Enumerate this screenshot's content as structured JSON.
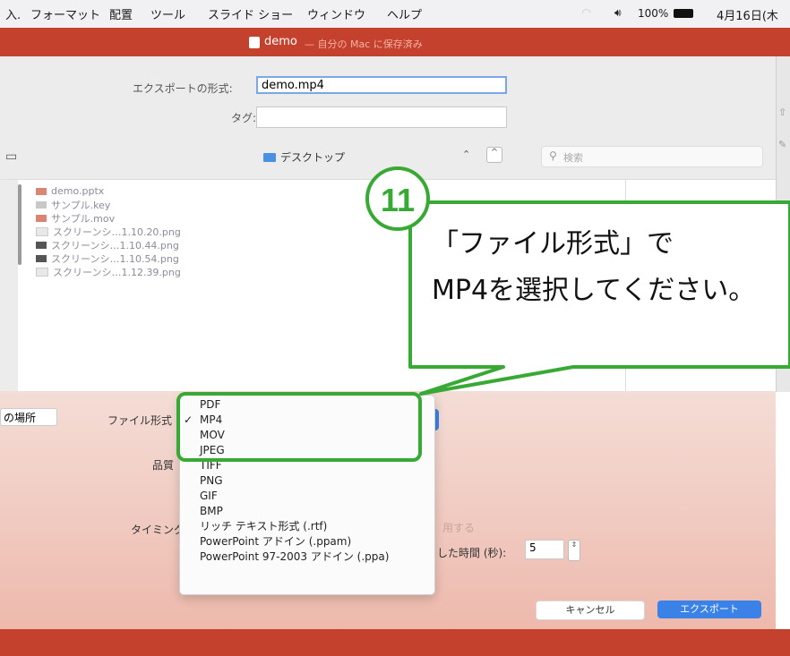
{
  "menubar": {
    "items": [
      "入.",
      "フォーマット",
      "配置",
      "ツール",
      "スライド ショー",
      "ウィンドウ",
      "ヘルプ"
    ],
    "volume_icon": "speaker-icon",
    "battery_text": "100%",
    "date_text": "4月16日(木"
  },
  "titlebar": {
    "title": "demo",
    "subtitle": "— 自分の Mac に保存済み",
    "color": "#c4412e"
  },
  "dialog": {
    "export_as_label": "エクスポートの形式:",
    "export_as_value": "demo.mp4",
    "tags_label": "タグ:",
    "tags_value": "",
    "location_label": "デスクトップ",
    "search_placeholder": "検索",
    "files": [
      {
        "name": "demo.pptx",
        "icon": "pptx-icon"
      },
      {
        "name": "サンプル.key",
        "icon": "keynote-icon"
      },
      {
        "name": "サンプル.mov",
        "icon": "movie-icon"
      },
      {
        "name": "スクリーンシ…1.10.20.png",
        "icon": "image-icon"
      },
      {
        "name": "スクリーンシ…1.10.44.png",
        "icon": "image-icon"
      },
      {
        "name": "スクリーンシ…1.10.54.png",
        "icon": "image-icon"
      },
      {
        "name": "スクリーンシ…1.12.39.png",
        "icon": "image-icon"
      }
    ]
  },
  "options": {
    "place_label": "の場所",
    "file_format_label": "ファイル形式",
    "quality_label": "品質",
    "timing_label": "タイミング",
    "timing_partial_1": "用する",
    "timing_partial_2": "した時間 (秒):",
    "seconds_value": "5"
  },
  "dropdown": {
    "items": [
      "PDF",
      "MP4",
      "MOV",
      "JPEG",
      "TIFF",
      "PNG",
      "GIF",
      "BMP",
      "リッチ テキスト形式 (.rtf)",
      "PowerPoint アドイン (.ppam)",
      "PowerPoint 97-2003 アドイン (.ppa)"
    ],
    "selected": "MP4",
    "check": "✓"
  },
  "buttons": {
    "cancel": "キャンセル",
    "export": "エクスポート"
  },
  "annotation": {
    "step_number": "11",
    "line1": "「ファイル形式」で",
    "line2": "MP4を選択してください。",
    "accent": "#39a935"
  }
}
